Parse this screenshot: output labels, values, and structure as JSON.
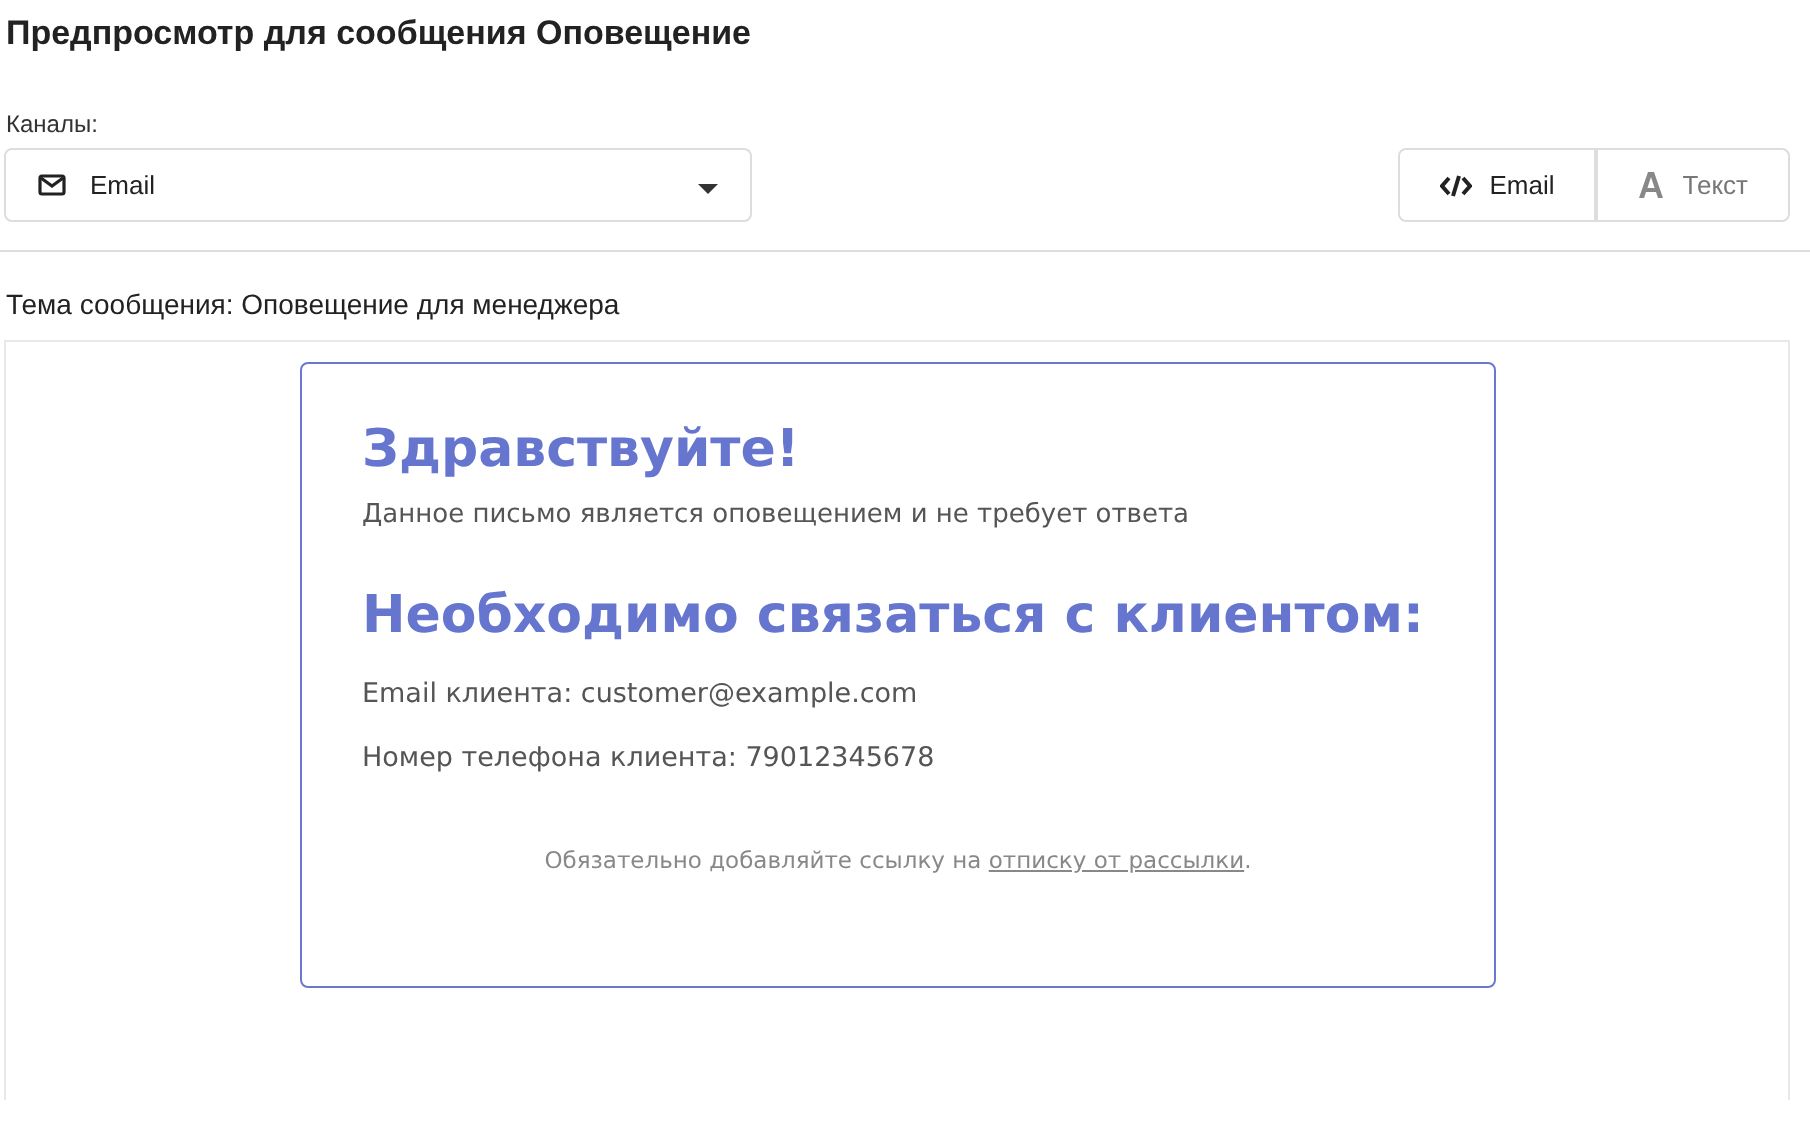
{
  "title": "Предпросмотр для сообщения Оповещение",
  "channels": {
    "label": "Каналы:",
    "value": "Email"
  },
  "view_tabs": [
    {
      "label": "Email",
      "kind": "code",
      "selected": true
    },
    {
      "label": "Текст",
      "kind": "text",
      "selected": false
    }
  ],
  "subject": "Тема сообщения: Оповещение для менеджера",
  "email": {
    "greeting": "Здравствуйте!",
    "notice": "Данное письмо является оповещением и не требует ответа",
    "heading": "Необходимо связаться с клиентом:",
    "lines": [
      "Email клиента: customer@example.com",
      "Номер телефона клиента: 79012345678"
    ],
    "footer": {
      "prefix": "Обязательно добавляйте ссылку на ",
      "link": "отписку от рассылки",
      "suffix": "."
    }
  }
}
